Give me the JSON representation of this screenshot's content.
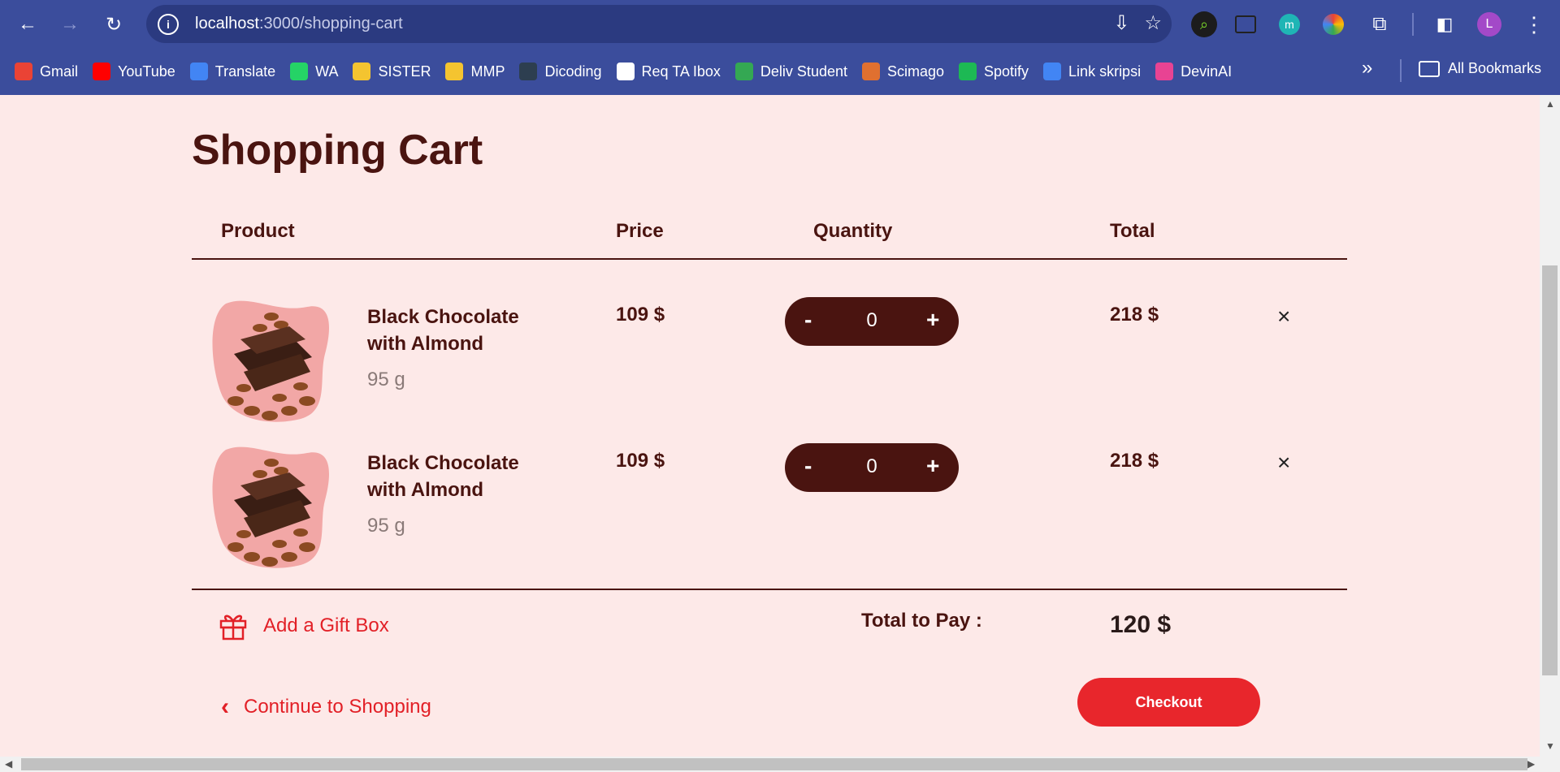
{
  "browser": {
    "url_host": "localhost",
    "url_path": ":3000/shopping-cart",
    "profile_initial": "L",
    "bookmarks": [
      {
        "label": "Gmail",
        "icon": "gmail-icon",
        "color": "#ea4335"
      },
      {
        "label": "YouTube",
        "icon": "youtube-icon",
        "color": "#ff0000"
      },
      {
        "label": "Translate",
        "icon": "translate-icon",
        "color": "#4285f4"
      },
      {
        "label": "WA",
        "icon": "whatsapp-icon",
        "color": "#25d366"
      },
      {
        "label": "SISTER",
        "icon": "sister-icon",
        "color": "#f4c430"
      },
      {
        "label": "MMP",
        "icon": "mmp-icon",
        "color": "#f4c430"
      },
      {
        "label": "Dicoding",
        "icon": "dicoding-icon",
        "color": "#2d3e50"
      },
      {
        "label": "Req TA Ibox",
        "icon": "google-icon",
        "color": "#ffffff"
      },
      {
        "label": "Deliv Student",
        "icon": "sheets-icon",
        "color": "#34a853"
      },
      {
        "label": "Scimago",
        "icon": "scimago-icon",
        "color": "#e07030"
      },
      {
        "label": "Spotify",
        "icon": "spotify-icon",
        "color": "#1db954"
      },
      {
        "label": "Link skripsi",
        "icon": "docs-icon",
        "color": "#4285f4"
      },
      {
        "label": "DevinAI",
        "icon": "devinai-icon",
        "color": "#e84393"
      }
    ],
    "all_bookmarks": "All Bookmarks"
  },
  "page": {
    "title": "Shopping Cart",
    "headers": {
      "product": "Product",
      "price": "Price",
      "quantity": "Quantity",
      "total": "Total"
    },
    "items": [
      {
        "name": "Black Chocolate with Almond",
        "weight": "95 g",
        "price": "109 $",
        "minus": "-",
        "qty": "0",
        "plus": "+",
        "total": "218 $",
        "remove": "×"
      },
      {
        "name": "Black Chocolate with Almond",
        "weight": "95 g",
        "price": "109 $",
        "minus": "-",
        "qty": "0",
        "plus": "+",
        "total": "218 $",
        "remove": "×"
      }
    ],
    "gift_box": "Add a Gift Box",
    "total_label": "Total to Pay :",
    "total_value": "120 $",
    "continue": "Continue to Shopping",
    "checkout": "Checkout"
  },
  "colors": {
    "brand": "#4a1410",
    "accent": "#e8262c",
    "background": "#fde9e8",
    "chrome": "#3b4d9c"
  }
}
